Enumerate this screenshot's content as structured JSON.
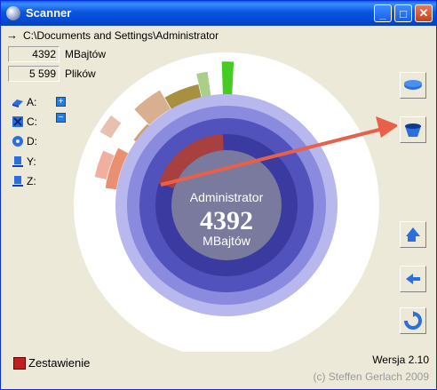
{
  "window": {
    "title": "Scanner"
  },
  "path": {
    "arrow": "→",
    "text": "C:\\Documents and Settings\\Administrator"
  },
  "stats": {
    "size_value": "4392",
    "size_unit": "MBajtów",
    "files_value": "5 599",
    "files_unit": "Plików"
  },
  "drives": [
    {
      "label": "A:",
      "icon": "floppy-icon"
    },
    {
      "label": "C:",
      "icon": "hard-drive-icon"
    },
    {
      "label": "D:",
      "icon": "cd-icon"
    },
    {
      "label": "Y:",
      "icon": "network-drive-icon"
    },
    {
      "label": "Z:",
      "icon": "network-drive-icon"
    }
  ],
  "expand": {
    "plus": "+",
    "minus": "−"
  },
  "center": {
    "name": "Administrator",
    "value": "4392",
    "unit": "MBajtów"
  },
  "footer": {
    "summary": "Zestawienie",
    "version": "Wersja  2.10",
    "copyright": "(c) Steffen Gerlach 2009"
  },
  "colors": {
    "accent": "#e8604a",
    "disk": "#6a6acc"
  }
}
